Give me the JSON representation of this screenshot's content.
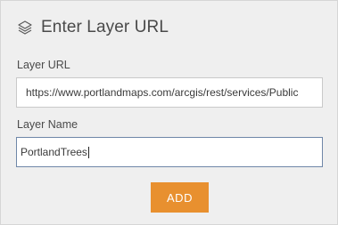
{
  "dialog": {
    "title": "Enter Layer URL",
    "icon": "layers-icon"
  },
  "fields": {
    "url": {
      "label": "Layer URL",
      "value": "https://www.portlandmaps.com/arcgis/rest/services/Public"
    },
    "name": {
      "label": "Layer Name",
      "value": "PortlandTrees"
    }
  },
  "actions": {
    "add_label": "ADD"
  },
  "colors": {
    "panel_bg": "#efefef",
    "accent_button": "#e8902f",
    "active_field_border": "#6f87a8"
  }
}
